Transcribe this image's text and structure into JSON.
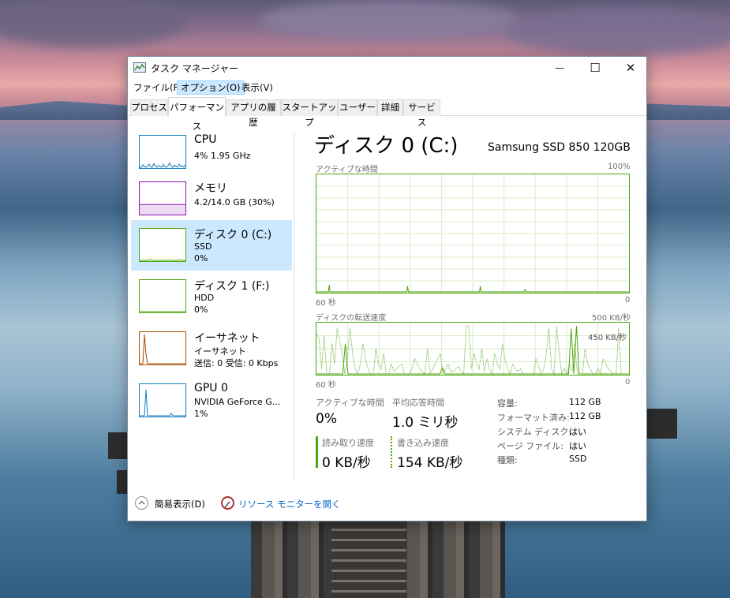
{
  "window": {
    "title": "タスク マネージャー",
    "controls": {
      "minimize": "—",
      "maximize": "☐",
      "close": "✕"
    }
  },
  "menubar": {
    "file": "ファイル(F)",
    "options": "オプション(O)",
    "view": "表示(V)"
  },
  "tabs": {
    "processes": "プロセス",
    "performance": "パフォーマンス",
    "app_history": "アプリの履歴",
    "startup": "スタートアップ",
    "users": "ユーザー",
    "details": "詳細",
    "services": "サービス"
  },
  "sidebar": {
    "cpu": {
      "title": "CPU",
      "line1": "4%  1.95 GHz",
      "color": "#117dbb",
      "spark": [
        0,
        0,
        8,
        2,
        0,
        4,
        10,
        1,
        0,
        12,
        3,
        0,
        6,
        2,
        0,
        9,
        1,
        0,
        5,
        14,
        2,
        0,
        7,
        3,
        0,
        10,
        2,
        5,
        0,
        8
      ]
    },
    "memory": {
      "title": "メモリ",
      "line1": "4.2/14.0 GB (30%)",
      "color": "#8b12ae",
      "spark": [
        30,
        30,
        30,
        30,
        30,
        30,
        30,
        30,
        30,
        30
      ]
    },
    "disk0": {
      "title": "ディスク 0 (C:)",
      "line1": "SSD",
      "line2": "0%",
      "color": "#4da60c",
      "spark": [
        0,
        0,
        0,
        0,
        0,
        0,
        0,
        3,
        0,
        0,
        0,
        0,
        0,
        0,
        0,
        0,
        0,
        0,
        2,
        0,
        0,
        0,
        0,
        0,
        0,
        2,
        0,
        0,
        0,
        0
      ]
    },
    "disk1": {
      "title": "ディスク 1 (F:)",
      "line1": "HDD",
      "line2": "0%",
      "color": "#4da60c",
      "spark": [
        0,
        0,
        0,
        0,
        0,
        0,
        0,
        0,
        0,
        0
      ]
    },
    "ethernet": {
      "title": "イーサネット",
      "line1": "イーサネット",
      "line2": "送信: 0 受信: 0 Kbps",
      "color": "#a74f01",
      "spark": [
        0,
        0,
        0,
        95,
        30,
        0,
        0,
        0,
        0,
        0,
        0,
        0,
        0,
        0,
        0,
        0,
        0,
        0,
        0,
        0,
        0,
        0,
        0,
        0,
        0,
        0,
        0,
        0,
        0,
        0
      ]
    },
    "gpu": {
      "title": "GPU 0",
      "line1": "NVIDIA GeForce G...",
      "line2": "1%",
      "color": "#117dbb",
      "spark": [
        0,
        0,
        0,
        0,
        85,
        0,
        0,
        0,
        0,
        0,
        0,
        0,
        0,
        0,
        0,
        0,
        0,
        0,
        0,
        0,
        8,
        0,
        0,
        0,
        0,
        0,
        0,
        0,
        0,
        0
      ]
    }
  },
  "main": {
    "title": "ディスク 0 (C:)",
    "device": "Samsung SSD 850 120GB",
    "graph1": {
      "label": "アクティブな時間",
      "max": "100%",
      "x_left": "60 秒",
      "x_right": "0",
      "values": [
        0,
        0,
        0,
        0,
        0,
        0,
        0,
        0,
        0,
        0,
        0,
        0,
        0,
        0,
        0,
        0,
        6,
        0,
        0,
        0,
        0,
        0,
        0,
        0,
        0,
        0,
        0,
        0,
        0,
        0,
        0,
        0,
        0,
        0,
        0,
        0,
        0,
        0,
        0,
        0,
        0,
        0,
        0,
        0,
        0,
        0,
        0,
        0,
        0,
        0,
        0,
        0,
        0,
        0,
        0,
        0,
        0,
        0,
        0,
        0,
        0,
        0,
        0,
        0,
        0,
        0,
        0,
        0,
        0,
        0,
        0,
        0,
        0,
        0,
        0,
        0,
        0,
        0,
        0,
        0,
        0,
        0,
        0,
        0,
        0,
        0,
        0,
        0,
        0,
        0,
        0,
        0,
        0,
        0,
        0,
        0,
        0,
        0,
        0,
        0,
        0,
        0,
        0,
        0,
        0,
        0,
        0,
        0,
        0,
        0,
        0,
        0,
        0,
        0,
        5,
        0,
        0,
        0,
        0,
        0,
        0,
        0,
        0,
        0,
        0,
        0,
        0,
        0,
        0,
        0,
        0,
        0,
        0,
        0,
        0,
        0,
        0,
        0,
        0,
        0,
        0,
        0,
        0,
        0,
        0,
        0,
        0,
        0,
        0,
        0,
        0,
        0,
        0,
        0,
        0,
        0,
        0,
        0,
        0,
        0,
        0,
        0,
        0,
        0,
        0,
        0,
        0,
        0,
        0,
        0,
        0,
        0,
        0,
        0,
        0,
        0,
        0,
        0,
        0,
        0,
        0,
        0,
        0,
        0,
        0,
        0,
        0,
        0,
        0,
        0,
        0,
        0,
        0,
        0,
        0,
        0,
        0,
        0,
        0,
        0,
        0,
        0,
        0,
        0,
        0,
        5,
        0,
        0,
        0,
        0,
        0,
        0,
        0,
        0,
        0,
        0,
        0,
        0,
        0,
        0,
        0,
        0,
        0,
        0,
        0,
        0,
        0,
        0,
        0,
        0,
        0,
        0,
        0,
        0,
        0,
        0,
        0,
        0,
        0,
        0,
        0,
        0,
        0,
        0,
        0,
        0,
        0,
        0,
        0,
        0,
        0,
        0,
        0,
        0,
        0,
        0,
        0,
        0,
        0,
        0,
        0,
        2,
        0,
        0,
        0,
        0,
        0,
        0,
        0,
        0,
        0,
        0,
        0,
        0,
        0,
        0,
        0,
        0,
        0,
        0,
        0,
        0,
        0,
        0,
        0,
        0,
        0,
        0,
        0,
        0,
        0,
        0,
        0,
        0,
        0,
        0,
        0,
        0,
        0,
        0,
        0,
        0,
        0,
        0,
        0,
        0,
        0,
        0,
        0,
        0,
        0,
        0,
        0,
        0,
        0,
        0,
        0,
        0,
        0,
        0,
        0,
        0,
        0,
        0,
        0,
        0,
        0,
        0,
        0,
        0,
        0,
        0,
        0,
        0,
        0,
        0,
        0,
        0,
        0,
        0,
        0,
        0,
        0,
        0,
        0,
        0,
        0,
        0,
        0,
        0,
        0,
        0,
        0,
        0,
        0,
        0,
        0,
        0,
        0,
        0,
        0,
        0,
        0,
        0,
        0,
        0,
        0,
        0,
        0,
        0,
        0,
        0,
        0,
        0,
        0,
        0,
        0,
        0,
        0,
        0,
        0,
        0,
        0,
        0,
        0,
        0,
        0,
        0,
        0,
        0,
        0,
        0
      ]
    },
    "graph2": {
      "label": "ディスクの転送速度",
      "max": "500 KB/秒",
      "secondary": "450 KB/秒",
      "x_left": "60 秒",
      "x_right": "0",
      "read": [
        0,
        0,
        0,
        0,
        0,
        0,
        0,
        0,
        0,
        0,
        0,
        60,
        0,
        0,
        0,
        0,
        0,
        0,
        0,
        0,
        0,
        0,
        0,
        0,
        0,
        0,
        0,
        0,
        0,
        0,
        0,
        0,
        0,
        0,
        0,
        0,
        0,
        0,
        0,
        0,
        0,
        0,
        0,
        0,
        0,
        0,
        0,
        0,
        12,
        0,
        0,
        0,
        0,
        0,
        0,
        0,
        0,
        0,
        0,
        0,
        0,
        0,
        0,
        0,
        0,
        0,
        0,
        0,
        0,
        0,
        0,
        0,
        0,
        0,
        0,
        0,
        0,
        0,
        0,
        0,
        0,
        0,
        0,
        0,
        0,
        0,
        0,
        0,
        0,
        0,
        0,
        0,
        0,
        0,
        0,
        0,
        0,
        90,
        0,
        95,
        0,
        0,
        0,
        0,
        0,
        0,
        0,
        0,
        0,
        0,
        0,
        0,
        0,
        0,
        0,
        0,
        0,
        0,
        0,
        0
      ],
      "write": [
        80,
        70,
        10,
        75,
        0,
        0,
        60,
        20,
        90,
        65,
        40,
        0,
        30,
        90,
        40,
        10,
        0,
        20,
        60,
        30,
        10,
        0,
        0,
        50,
        20,
        10,
        40,
        0,
        0,
        20,
        5,
        10,
        15,
        20,
        0,
        0,
        0,
        10,
        30,
        20,
        10,
        5,
        0,
        50,
        0,
        10,
        20,
        30,
        40,
        0,
        10,
        20,
        5,
        5,
        10,
        15,
        5,
        0,
        95,
        95,
        10,
        40,
        20,
        10,
        50,
        5,
        30,
        10,
        0,
        40,
        20,
        10,
        60,
        30,
        10,
        0,
        20,
        10,
        5,
        10,
        0,
        0,
        0,
        0,
        0,
        30,
        15,
        0,
        10,
        40,
        90,
        10,
        0,
        95,
        40,
        0,
        10,
        0,
        20,
        5,
        60,
        0,
        0,
        0,
        50,
        20,
        10,
        0,
        0,
        10,
        0,
        30,
        20,
        10,
        5,
        0,
        0,
        90,
        0,
        0,
        0,
        0
      ]
    },
    "stats": {
      "active_time_label": "アクティブな時間",
      "active_time_value": "0%",
      "avg_response_label": "平均応答時間",
      "avg_response_value": "1.0 ミリ秒",
      "read_label": "読み取り速度",
      "read_value": "0 KB/秒",
      "write_label": "書き込み速度",
      "write_value": "154 KB/秒"
    },
    "props": [
      {
        "label": "容量:",
        "value": "112 GB"
      },
      {
        "label": "フォーマット済み:",
        "value": "112 GB"
      },
      {
        "label": "システム ディスク:",
        "value": "はい"
      },
      {
        "label": "ページ ファイル:",
        "value": "はい"
      },
      {
        "label": "種類:",
        "value": "SSD"
      }
    ]
  },
  "footer": {
    "fewer_details": "簡易表示(D)",
    "resource_monitor": "リソース モニターを開く"
  }
}
